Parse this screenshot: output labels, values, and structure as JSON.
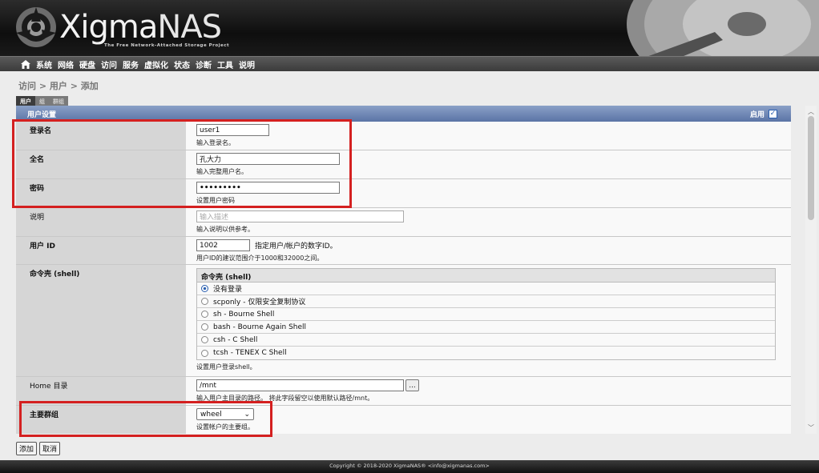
{
  "app": {
    "logo_main": "Xigma",
    "logo_nas": "NAS",
    "logo_sub": "The Free Network-Attached Storage Project"
  },
  "nav": [
    "系统",
    "网络",
    "硬盘",
    "访问",
    "服务",
    "虚拟化",
    "状态",
    "诊断",
    "工具",
    "说明"
  ],
  "breadcrumb": "访问 > 用户 > 添加",
  "tabs": [
    "用户",
    "组",
    "群组"
  ],
  "section": {
    "title": "用户设置",
    "enable_label": "启用",
    "enabled": true
  },
  "fields": {
    "login": {
      "label": "登录名",
      "value": "user1",
      "hint": "输入登录名。"
    },
    "fullname": {
      "label": "全名",
      "value": "孔大力",
      "hint": "输入完整用户名。"
    },
    "password": {
      "label": "密码",
      "value": "•••••••••",
      "hint": "设置用户密码"
    },
    "description": {
      "label": "说明",
      "placeholder": "输入描述",
      "hint": "输入说明以供参考。"
    },
    "uid": {
      "label": "用户 ID",
      "value": "1002",
      "inline_hint": "指定用户/帐户的数字ID。",
      "hint": "用户ID的建议范围介于1000和32000之间。"
    },
    "shell": {
      "label": "命令壳 (shell)",
      "table_header": "命令壳 (shell)",
      "options": [
        "没有登录",
        "scponly - 仅限安全复制协议",
        "sh - Bourne Shell",
        "bash - Bourne Again Shell",
        "csh - C Shell",
        "tcsh - TENEX C Shell"
      ],
      "selected": "没有登录",
      "hint": "设置用户登录shell。"
    },
    "home": {
      "label": "Home 目录",
      "value": "/mnt",
      "browse": "...",
      "hint": "输入用户主目录的路径。 将此字段留空以使用默认路径/mnt。"
    },
    "group": {
      "label": "主要群组",
      "value": "wheel",
      "hint": "设置帐户的主要组。"
    }
  },
  "buttons": {
    "add": "添加",
    "cancel": "取消"
  },
  "footer": "Copyright © 2018-2020 XigmaNAS® <info@xigmanas.com>",
  "colors": {
    "highlight": "#d42020",
    "section_header": "#6a82b2"
  }
}
